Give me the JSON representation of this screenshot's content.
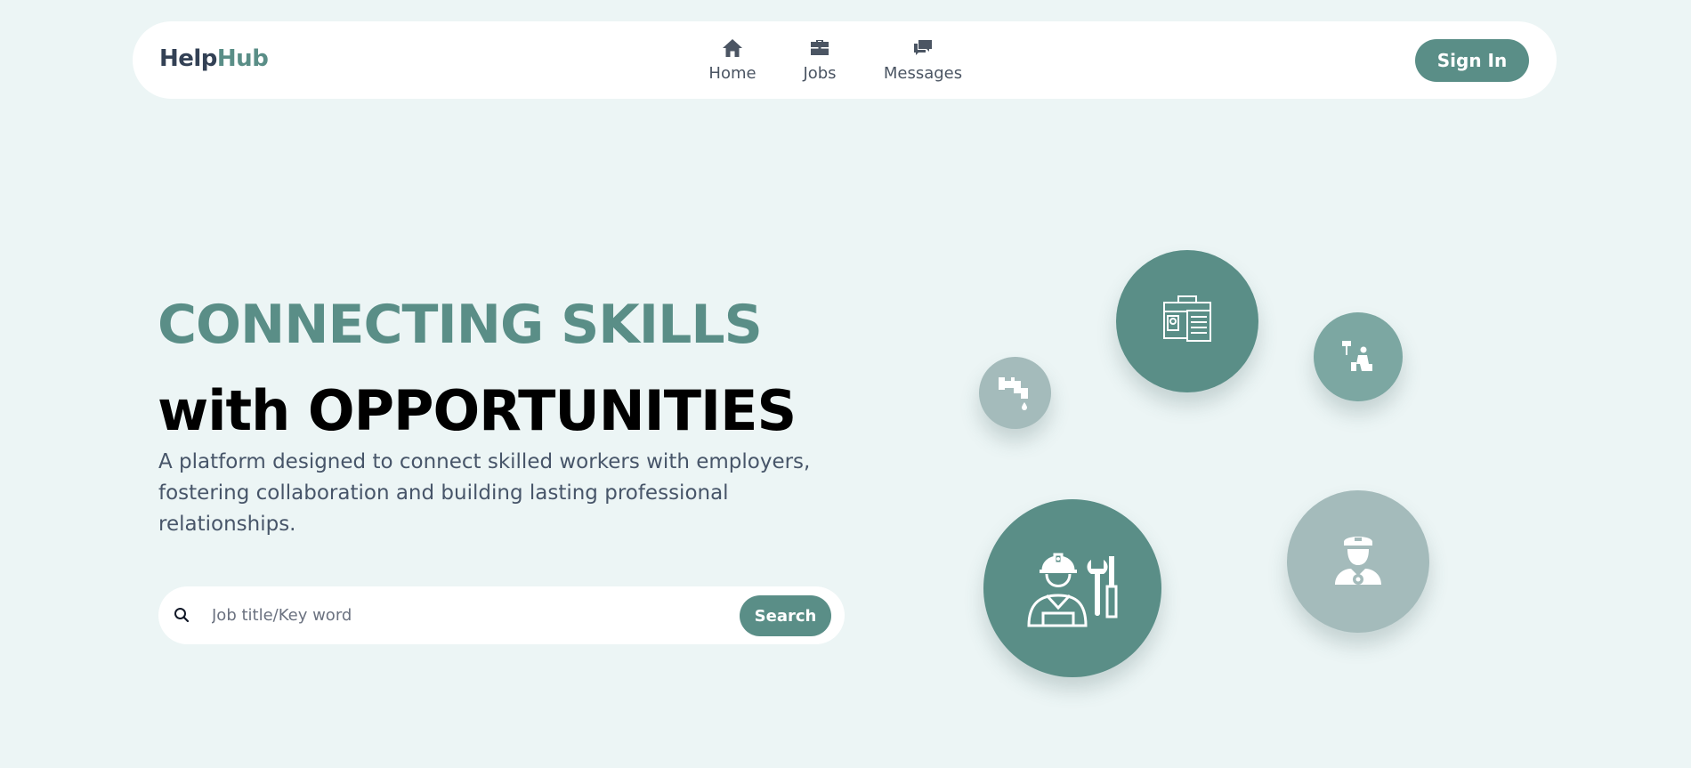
{
  "header": {
    "logo_part1": "Help",
    "logo_part2": "Hub",
    "nav": [
      {
        "label": "Home",
        "icon": "home-icon"
      },
      {
        "label": "Jobs",
        "icon": "briefcase-icon"
      },
      {
        "label": "Messages",
        "icon": "chat-icon"
      }
    ],
    "signin_label": "Sign In"
  },
  "hero": {
    "title_line1": "CONNECTING SKILLS",
    "title_line2": "with OPPORTUNITIES",
    "description": "A platform designed to connect skilled workers with employers, fostering collaboration and building lasting professional relationships.",
    "search": {
      "placeholder": "Job title/Key word",
      "value": "",
      "button_label": "Search"
    }
  },
  "illustrations": [
    {
      "icon": "toolbox-clipboard-icon"
    },
    {
      "icon": "faucet-icon"
    },
    {
      "icon": "painter-icon"
    },
    {
      "icon": "mechanic-worker-icon"
    },
    {
      "icon": "driver-icon"
    }
  ],
  "colors": {
    "background": "#ecf5f5",
    "accent": "#5a8e87",
    "accent_light": "#a4bbbb",
    "text_dark": "#334155"
  }
}
